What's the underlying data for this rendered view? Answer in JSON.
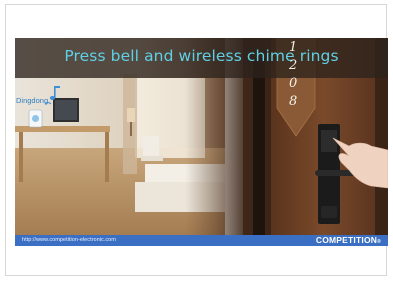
{
  "slide": {
    "title": "Press bell and wireless chime rings",
    "chime_caption": "Dingdong",
    "door_number": "1208",
    "footer_url": "http://www.competition-electronic.com",
    "brand": "COMPETITION",
    "brand_mark": "®"
  },
  "colors": {
    "title_text": "#5fd0e6",
    "title_band": "#2d231c",
    "footer_bar": "#3a6fc4",
    "door_wood": "#6a3e22"
  },
  "icons": [
    "music-note-icon",
    "wireless-chime-icon",
    "hand-pointer-icon",
    "door-lock-icon"
  ]
}
